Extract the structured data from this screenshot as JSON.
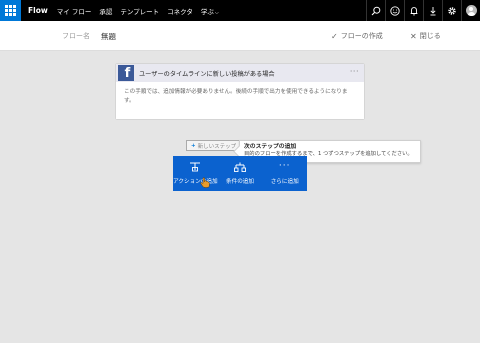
{
  "nav": {
    "brand": "Flow",
    "items": [
      "マイ フロー",
      "承認",
      "テンプレート",
      "コネクタ",
      "学ぶ"
    ],
    "learn_caret": "⌵",
    "icons": [
      "search-icon",
      "smiley-icon",
      "bell-icon",
      "download-icon",
      "gear-icon",
      "avatar"
    ]
  },
  "header": {
    "flow_name_label": "フロー名",
    "flow_name_value": "無題",
    "create_glyph": "✓",
    "create_label": "フローの作成",
    "close_glyph": "✕",
    "close_label": "閉じる"
  },
  "trigger": {
    "icon_letter": "f",
    "title": "ユーザーのタイムラインに新しい投稿がある場合",
    "menu": "···",
    "body": "この手順では、追加情報が必要ありません。後続の手順で出力を使用できるようになります。"
  },
  "new_step": {
    "plus": "+",
    "label": "新しいステップ"
  },
  "tooltip": {
    "title": "次のステップの追加",
    "body": "目的のフローを作成するまで、1 つずつステップを追加してください。"
  },
  "actions": {
    "add_action": "アクションの追加",
    "add_condition": "条件の追加",
    "more": "さらに追加",
    "more_dots": "···"
  },
  "colors": {
    "topbar": "#000000",
    "waffle": "#0078d7",
    "action_bar": "#0b62cf",
    "facebook": "#3b5998",
    "canvas": "#e5e5e5"
  }
}
